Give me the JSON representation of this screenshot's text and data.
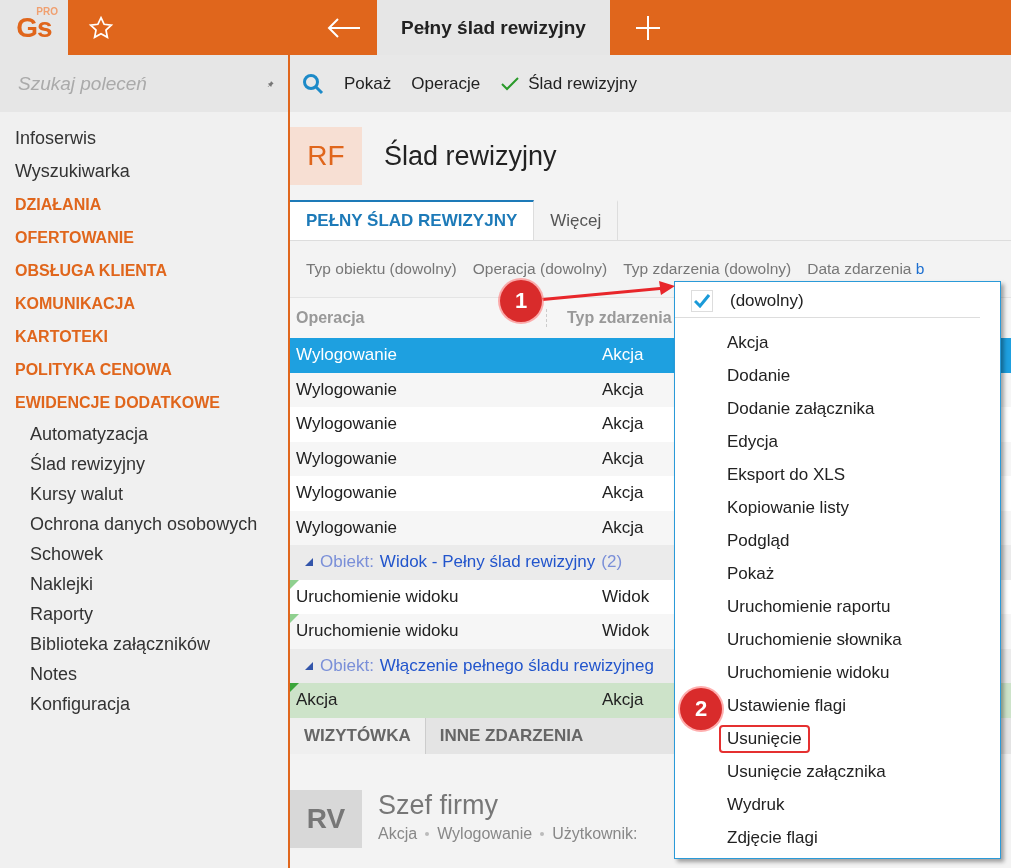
{
  "topbar": {
    "logo": "Gs",
    "logo_badge": "PRO",
    "tab": "Pełny ślad rewizyjny"
  },
  "sidebar": {
    "search": {
      "placeholder": "Szukaj poleceń"
    },
    "items": [
      {
        "kind": "link",
        "label": "Infoserwis"
      },
      {
        "kind": "link",
        "label": "Wyszukiwarka"
      },
      {
        "kind": "section",
        "label": "DZIAŁANIA"
      },
      {
        "kind": "section",
        "label": "OFERTOWANIE"
      },
      {
        "kind": "section",
        "label": "OBSŁUGA KLIENTA"
      },
      {
        "kind": "section",
        "label": "KOMUNIKACJA"
      },
      {
        "kind": "section",
        "label": "KARTOTEKI"
      },
      {
        "kind": "section",
        "label": "POLITYKA CENOWA"
      },
      {
        "kind": "section",
        "label": "EWIDENCJE DODATKOWE",
        "children": [
          {
            "label": "Automatyzacja"
          },
          {
            "label": "Ślad rewizyjny"
          },
          {
            "label": "Kursy walut"
          },
          {
            "label": "Ochrona danych osobowych"
          },
          {
            "label": "Schowek"
          },
          {
            "label": "Naklejki"
          },
          {
            "label": "Raporty"
          },
          {
            "label": "Biblioteka załączników"
          },
          {
            "label": "Notes"
          },
          {
            "label": "Konfiguracja"
          }
        ]
      }
    ]
  },
  "toolbar": [
    {
      "kind": "search",
      "label": "Pokaż"
    },
    {
      "kind": "plain",
      "label": "Operacje"
    },
    {
      "kind": "check",
      "label": "Ślad rewizyjny"
    }
  ],
  "header": {
    "badge": "RF",
    "title": "Ślad rewizyjny"
  },
  "tabs": [
    {
      "label": "PEŁNY ŚLAD REWIZYJNY",
      "selected": true
    },
    {
      "label": "Więcej",
      "selected": false
    }
  ],
  "filters": [
    {
      "label": "Typ obiektu (dowolny)"
    },
    {
      "label": "Operacja (dowolny)"
    },
    {
      "label": "Typ zdarzenia (dowolny)"
    },
    {
      "label": "Data zdarzenia",
      "link": "b"
    }
  ],
  "table": {
    "columns": [
      "Operacja",
      "Typ zdarzenia"
    ],
    "rows": [
      {
        "kind": "row",
        "cells": [
          "Wylogowanie",
          "Akcja"
        ],
        "selected": true,
        "flagged": false,
        "tinted": false
      },
      {
        "kind": "row",
        "cells": [
          "Wylogowanie",
          "Akcja"
        ],
        "selected": false,
        "flagged": false,
        "tinted": false
      },
      {
        "kind": "row",
        "cells": [
          "Wylogowanie",
          "Akcja"
        ],
        "selected": false,
        "flagged": false,
        "tinted": false
      },
      {
        "kind": "row",
        "cells": [
          "Wylogowanie",
          "Akcja"
        ],
        "selected": false,
        "flagged": false,
        "tinted": false
      },
      {
        "kind": "row",
        "cells": [
          "Wylogowanie",
          "Akcja"
        ],
        "selected": false,
        "flagged": false,
        "tinted": false
      },
      {
        "kind": "row",
        "cells": [
          "Wylogowanie",
          "Akcja"
        ],
        "selected": false,
        "flagged": false,
        "tinted": false
      },
      {
        "kind": "group",
        "label": "Obiekt:",
        "value": "Widok - Pełny ślad rewizyjny",
        "count": "(2)",
        "expanded": true
      },
      {
        "kind": "row",
        "cells": [
          "Uruchomienie widoku",
          "Widok"
        ],
        "selected": false,
        "flagged": true,
        "tinted": false
      },
      {
        "kind": "row",
        "cells": [
          "Uruchomienie widoku",
          "Widok"
        ],
        "selected": false,
        "flagged": true,
        "tinted": false
      },
      {
        "kind": "group",
        "label": "Obiekt:",
        "value": "Włączenie pełnego śladu rewizyjneg",
        "expanded": true
      },
      {
        "kind": "row",
        "cells": [
          "Akcja",
          "Akcja"
        ],
        "selected": false,
        "flagged": true,
        "tinted": true
      }
    ]
  },
  "detail_tabs": [
    {
      "label": "WIZYTÓWKA",
      "selected": true
    },
    {
      "label": "INNE ZDARZENIA",
      "selected": false
    }
  ],
  "detail": {
    "badge": "RV",
    "title": "Szef firmy",
    "meta": [
      "Akcja",
      "Wylogowanie",
      "Użytkownik:"
    ]
  },
  "dropdown": {
    "items": [
      {
        "label": "(dowolny)",
        "checked": true,
        "highlighted": false
      },
      {
        "label": "Akcja",
        "highlighted": false
      },
      {
        "label": "Dodanie",
        "highlighted": false
      },
      {
        "label": "Dodanie załącznika",
        "highlighted": false
      },
      {
        "label": "Edycja",
        "highlighted": false
      },
      {
        "label": "Eksport do XLS",
        "highlighted": false
      },
      {
        "label": "Kopiowanie listy",
        "highlighted": false
      },
      {
        "label": "Podgląd",
        "highlighted": false
      },
      {
        "label": "Pokaż",
        "highlighted": false
      },
      {
        "label": "Uruchomienie raportu",
        "highlighted": false
      },
      {
        "label": "Uruchomienie słownika",
        "highlighted": false
      },
      {
        "label": "Uruchomienie widoku",
        "highlighted": false
      },
      {
        "label": "Ustawienie flagi",
        "highlighted": false
      },
      {
        "label": "Usunięcie",
        "highlighted": true
      },
      {
        "label": "Usunięcie załącznika",
        "highlighted": false
      },
      {
        "label": "Wydruk",
        "highlighted": false
      },
      {
        "label": "Zdjęcie flagi",
        "highlighted": false
      }
    ]
  },
  "annotations": [
    {
      "label": "1"
    },
    {
      "label": "2"
    }
  ]
}
